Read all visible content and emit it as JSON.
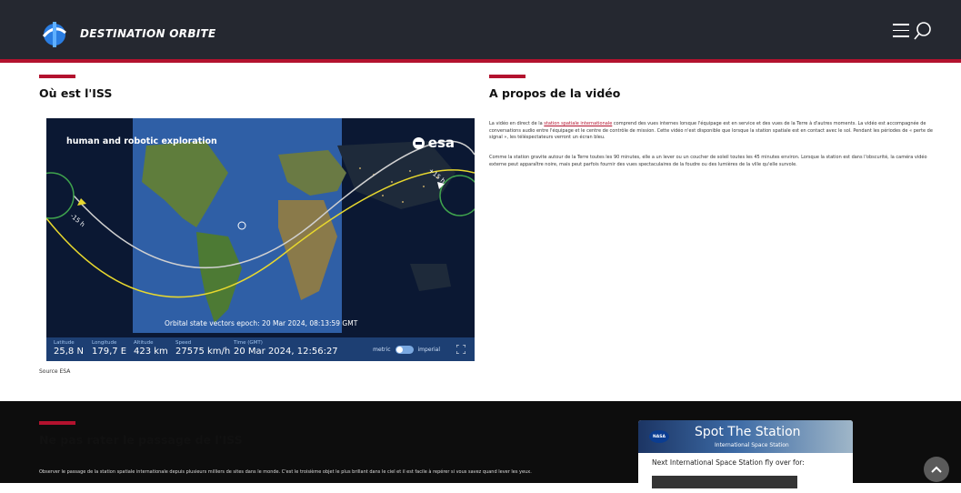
{
  "header": {
    "brand": "DESTINATION ORBITE",
    "menu_icon": "hamburger-icon",
    "search_icon": "search-icon",
    "accent_color": "#b3122e"
  },
  "iss_section": {
    "title": "Où est l'ISS",
    "tracker": {
      "banner": "human and robotic exploration",
      "logo_text": "esa",
      "epoch": "Orbital state vectors epoch: 20 Mar 2024, 08:13:59 GMT",
      "orbit_labels": [
        "-15 h",
        "+15 h"
      ],
      "stats": [
        {
          "label": "Latitude",
          "value": "25,8 N"
        },
        {
          "label": "Longitude",
          "value": "179,7 E"
        },
        {
          "label": "Altitude",
          "value": "423 km"
        },
        {
          "label": "Speed",
          "value": "27575 km/h"
        },
        {
          "label": "Time (GMT)",
          "value": "20 Mar 2024, 12:56:27"
        }
      ],
      "units": {
        "metric": "metric",
        "imperial": "imperial"
      }
    },
    "source": "Source ESA"
  },
  "about_section": {
    "title": "A propos de la vidéo",
    "p1_before": "La vidéo en direct de la ",
    "p1_link": "station spatiale internationale",
    "p1_after": " comprend des vues internes lorsque l'équipage est en service et des vues de la Terre à d'autres moments. La vidéo est accompagnée de conversations audio entre l'équipage et le centre de contrôle de mission. Cette vidéo n'est disponible que lorsque la station spatiale est en contact avec le sol. Pendant les périodes de « perte de signal », les téléspectateurs verront un écran bleu.",
    "p2": "Comme la station gravite autour de la Terre toutes les 90 minutes, elle a un lever ou un coucher de soleil toutes les 45 minutes environ. Lorsque la station est dans l'obscurité, la caméra vidéo externe peut apparaître noire, mais peut parfois fournir des vues spectaculaires de la foudre ou des lumières de la ville qu'elle survole."
  },
  "pass_section": {
    "title": "Ne pas rater le passage de l'ISS",
    "text": "Observer le passage de la station spatiale internationale depuis plusieurs milliers de sites dans le monde. C'est le troisième objet le plus brillant dans le ciel et il est facile à repérer si vous savez quand lever les yeux.",
    "widget": {
      "badge": "NASA",
      "title": "Spot The Station",
      "subtitle": "International Space Station",
      "next": "Next International Space Station fly over for:"
    }
  },
  "scroll_top_icon": "chevron-up-icon"
}
